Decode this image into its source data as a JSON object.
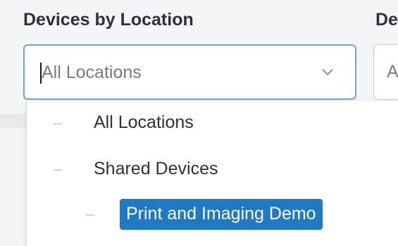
{
  "filters": {
    "location": {
      "label": "Devices by Location",
      "value": "All Locations"
    },
    "second": {
      "label": "De",
      "value": "A"
    }
  },
  "dropdown": {
    "items": [
      {
        "label": "All Locations",
        "selected": false
      },
      {
        "label": "Shared Devices",
        "selected": false
      },
      {
        "label": "Print and Imaging Demo",
        "selected": true
      }
    ]
  },
  "colors": {
    "selection": "#1f7ac3",
    "focus_border": "#6ea3d8"
  }
}
